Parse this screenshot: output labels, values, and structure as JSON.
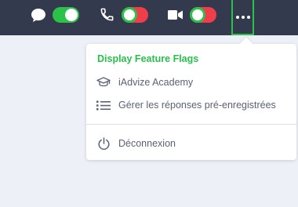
{
  "topbar": {
    "chat_icon": "chat-bubble-icon",
    "chat_toggle": "on",
    "phone_icon": "phone-icon",
    "phone_toggle": "off",
    "video_icon": "video-camera-icon",
    "video_toggle": "off",
    "more_icon": "more-horizontal-icon",
    "toggle_on_color": "#2bc24a",
    "toggle_off_color": "#ef3e4a",
    "bar_color": "#333a4d"
  },
  "menu": {
    "feature_flags_label": "Display Feature Flags",
    "feature_flags_color": "#28c04a",
    "items": [
      {
        "label": "iAdvize Academy",
        "icon": "graduation-cap-icon"
      },
      {
        "label": "Gérer les réponses pré-enregistrées",
        "icon": "list-icon"
      }
    ],
    "logout": {
      "label": "Déconnexion",
      "icon": "power-icon"
    }
  }
}
